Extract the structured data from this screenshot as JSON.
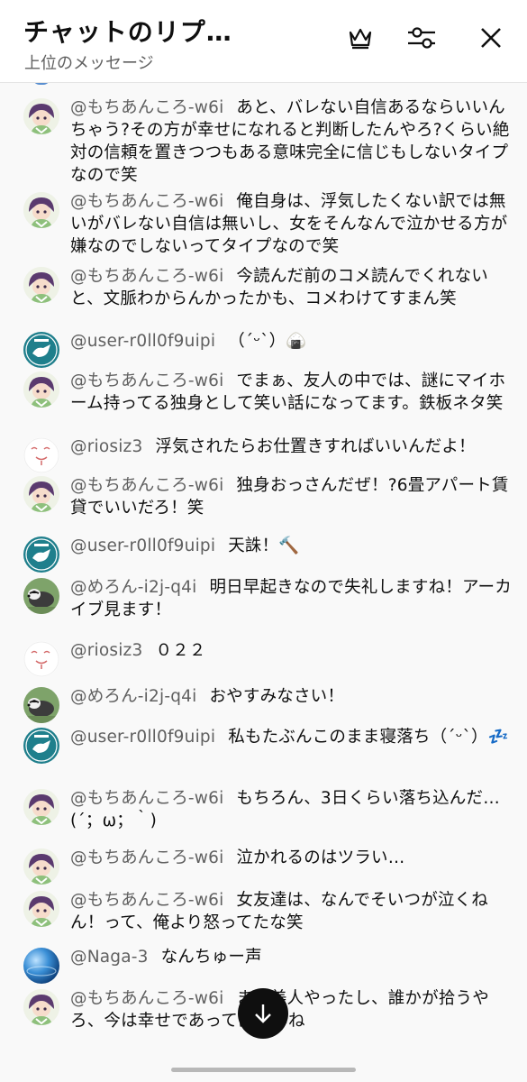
{
  "header": {
    "title": "チャットのリプ…",
    "subtitle": "上位のメッセージ",
    "icons": [
      "crown-icon",
      "filter-sliders-icon",
      "close-icon"
    ]
  },
  "messages": [
    {
      "author": "@もちあんころ-w6i",
      "text": "あと、バレない自信あるならいいんちゃう?その方が幸せになれると判断したんやろ?くらい絶対の信頼を置きつつもある意味完全に信じもしないタイプなので笑",
      "avatar": "anime-avatar"
    },
    {
      "author": "@もちあんころ-w6i",
      "text": "俺自身は、浮気したくない訳では無いがバレない自信は無いし、女をそんなんで泣かせる方が嫌なのでしないってタイプなので笑",
      "avatar": "anime-avatar"
    },
    {
      "author": "@もちあんころ-w6i",
      "text": "今読んだ前のコメ読んでくれないと、文脈わからんかったかも、コメわけてすまん笑",
      "avatar": "anime-avatar"
    },
    {
      "author": "@user-r0ll0f9uipi",
      "text": "（ˊᵕˋ）🍙",
      "avatar": "teal-avatar"
    },
    {
      "author": "@もちあんころ-w6i",
      "text": "でまぁ、友人の中では、謎にマイホーム持ってる独身として笑い話になってます。鉄板ネタ笑",
      "avatar": "anime-avatar"
    },
    {
      "author": "@riosiz3",
      "text": "浮気されたらお仕置きすればいいんだよ！",
      "avatar": "sketch-avatar"
    },
    {
      "author": "@もちあんころ-w6i",
      "text": "独身おっさんだぜ！?6畳アパート賃貸でいいだろ！笑",
      "avatar": "anime-avatar"
    },
    {
      "author": "@user-r0ll0f9uipi",
      "text": "天誅！🔨",
      "avatar": "teal-avatar"
    },
    {
      "author": "@めろん-i2j-q4i",
      "text": "明日早起きなので失礼しますね！アーカイブ見ます！",
      "avatar": "badger-avatar"
    },
    {
      "author": "@riosiz3",
      "text": "０２２",
      "avatar": "sketch-avatar"
    },
    {
      "author": "@めろん-i2j-q4i",
      "text": "おやすみなさい！",
      "avatar": "badger-avatar"
    },
    {
      "author": "@user-r0ll0f9uipi",
      "text": "私もたぶんこのまま寝落ち（ˊᵕˋ）💤",
      "avatar": "teal-avatar"
    },
    {
      "author": "@もちあんころ-w6i",
      "text": "もちろん、3日くらい落ち込んだ…(´；ω；｀)",
      "avatar": "anime-avatar"
    },
    {
      "author": "@もちあんころ-w6i",
      "text": "泣かれるのはツラい…",
      "avatar": "anime-avatar"
    },
    {
      "author": "@もちあんころ-w6i",
      "text": "女友達は、なんでそいつが泣くねん！って、俺より怒ってたな笑",
      "avatar": "anime-avatar"
    },
    {
      "author": "@Naga-3",
      "text": "なんちゅー声",
      "avatar": "globe-avatar"
    },
    {
      "author": "@もちあんころ-w6i",
      "text": "まぁ美人やったし、誰かが拾うやろ、今は幸せであってほしいね",
      "avatar": "anime-avatar"
    }
  ],
  "colors": {
    "background": "#f9f9f9",
    "author": "#606060",
    "text": "#0f0f0f",
    "fab": "#0f0f0f"
  },
  "scroll_button": {
    "icon": "arrow-down-icon"
  }
}
